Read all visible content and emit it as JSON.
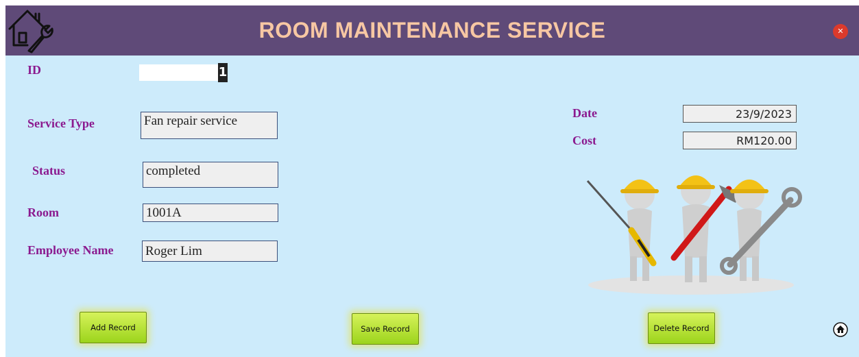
{
  "window": {
    "title": "ROOM MAINTENANCE SERVICE",
    "close_icon": "close-icon"
  },
  "form": {
    "id_label": "ID",
    "id_value": "1",
    "service_type_label": "Service Type",
    "service_type_value": "Fan repair service",
    "status_label": "Status",
    "status_value": "completed",
    "room_label": "Room",
    "room_value": "1001A",
    "employee_name_label": "Employee Name",
    "employee_name_value": "Roger Lim",
    "date_label": "Date",
    "date_value": "23/9/2023",
    "cost_label": "Cost",
    "cost_value": "RM120.00"
  },
  "buttons": {
    "add": "Add Record",
    "save": "Save Record",
    "delete": "Delete Record"
  },
  "icons": {
    "logo": "house-wrench-icon",
    "home": "home-icon",
    "illustration": "workers-with-tools-illustration"
  },
  "colors": {
    "header_bg": "#5f4a78",
    "title_text": "#f7c7a3",
    "form_bg": "#cdebfb",
    "label_text": "#8b1a8f",
    "button_bg": "#b4e033",
    "close_button": "#dc3a2c"
  }
}
